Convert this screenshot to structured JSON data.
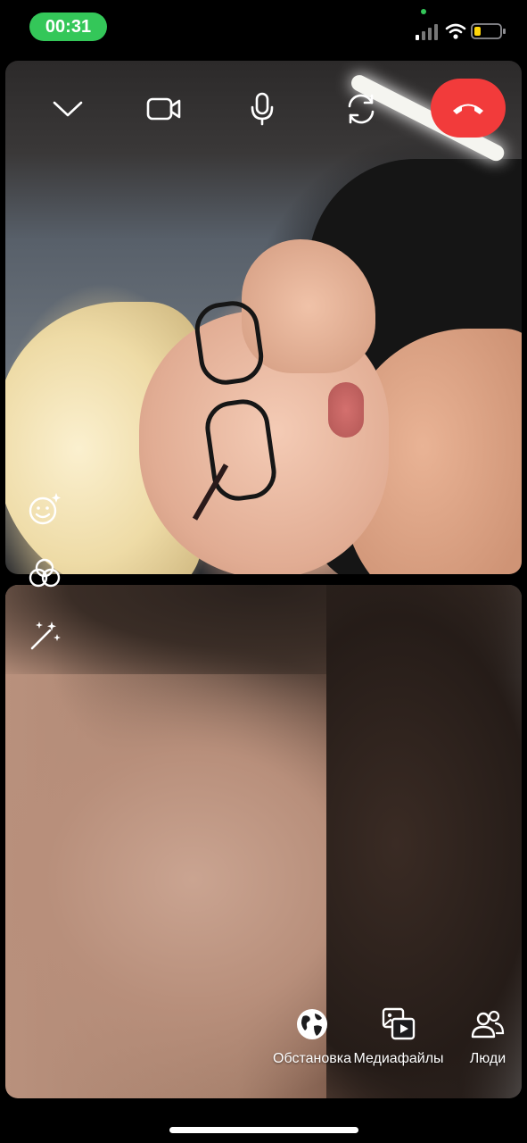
{
  "status_bar": {
    "time": "00:31",
    "accent_color": "#34c759",
    "icons": [
      "cellular-signal-icon",
      "wifi-icon",
      "battery-icon"
    ],
    "battery_level": 0.25,
    "battery_color": "#ffd60a"
  },
  "call_controls": {
    "items": [
      "chevron-down-icon",
      "video-camera-icon",
      "microphone-icon",
      "flip-camera-icon",
      "end-call-icon"
    ],
    "end_call_color": "#f23b3b"
  },
  "effects": {
    "items": [
      "face-effects-icon",
      "filters-icon",
      "magic-wand-icon"
    ]
  },
  "bottom_toolbar": {
    "scene_label": "Обстановка",
    "media_label": "Медиафайлы",
    "people_label": "Люди"
  }
}
